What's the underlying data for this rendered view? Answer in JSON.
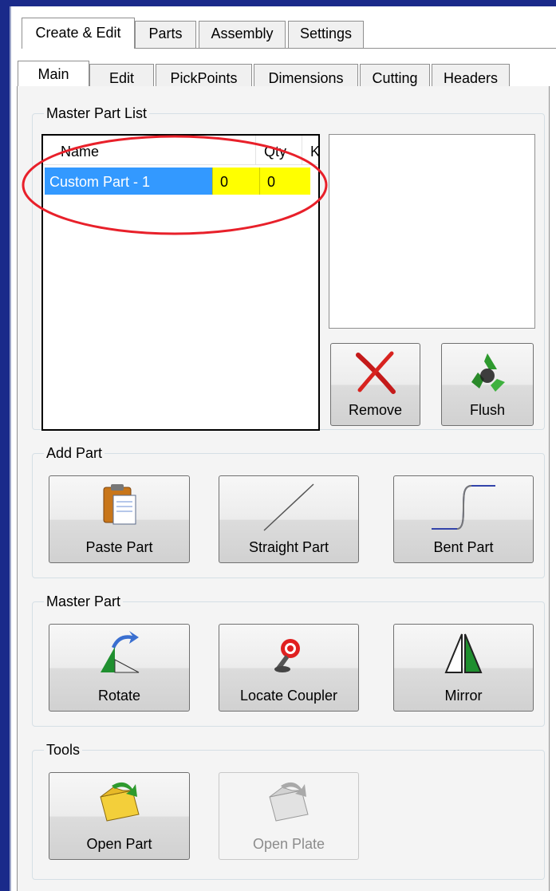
{
  "outer_tabs": [
    "Create & Edit",
    "Parts",
    "Assembly",
    "Settings"
  ],
  "inner_tabs": [
    "Main",
    "Edit",
    "PickPoints",
    "Dimensions",
    "Cutting",
    "Headers"
  ],
  "master_part_list": {
    "title": "Master Part List",
    "columns": [
      "Name",
      "Qty",
      "Key"
    ],
    "rows": [
      {
        "name": "Custom Part - 1",
        "qty": "0",
        "key": "0"
      }
    ],
    "selected_color": "#3399ff",
    "highlight_color": "#ffff00",
    "remove_label": "Remove",
    "flush_label": "Flush"
  },
  "add_part": {
    "title": "Add Part",
    "paste_label": "Paste Part",
    "straight_label": "Straight Part",
    "bent_label": "Bent Part"
  },
  "master_part": {
    "title": "Master Part",
    "rotate_label": "Rotate",
    "locate_label": "Locate Coupler",
    "mirror_label": "Mirror"
  },
  "tools": {
    "title": "Tools",
    "open_part_label": "Open Part",
    "open_plate_label": "Open Plate"
  },
  "annotation_color": "#e8202a"
}
